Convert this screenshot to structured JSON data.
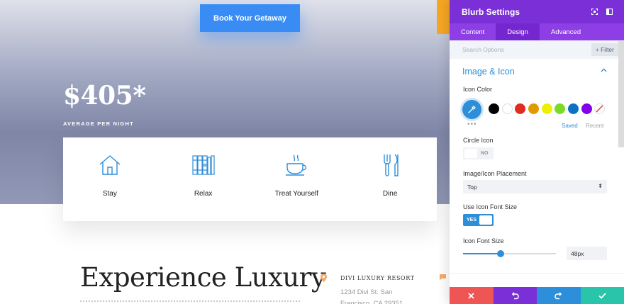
{
  "hero": {
    "cta_label": "Book Your Getaway",
    "price": "$405*",
    "price_caption": "AVERAGE PER NIGHT"
  },
  "features": [
    {
      "label": "Stay",
      "icon": "house-icon"
    },
    {
      "label": "Relax",
      "icon": "books-icon"
    },
    {
      "label": "Treat Yourself",
      "icon": "coffee-cup-icon"
    },
    {
      "label": "Dine",
      "icon": "fork-knife-icon"
    }
  ],
  "content": {
    "heading": "Experience Luxury",
    "resort_name": "DIVI LUXURY RESORT",
    "address_line1": "1234 Divi St. San",
    "address_line2": "Francisco, CA 29351"
  },
  "panel": {
    "title": "Blurb Settings",
    "tabs": [
      "Content",
      "Design",
      "Advanced"
    ],
    "active_tab": "Design",
    "search_placeholder": "Search Options",
    "filter_label": "+ Filter",
    "section_title": "Image & Icon",
    "icon_color_label": "Icon Color",
    "selected_color": "#2d8ed9",
    "swatches": [
      "#000000",
      "#ffffff",
      "#e02b20",
      "#e09900",
      "#edf000",
      "#7cda24",
      "#0c71c3",
      "#8300e9"
    ],
    "saved_label": "Saved",
    "recent_label": "Recent",
    "circle_icon_label": "Circle Icon",
    "circle_icon_value": "NO",
    "placement_label": "Image/Icon Placement",
    "placement_value": "Top",
    "use_font_size_label": "Use Icon Font Size",
    "use_font_size_value": "YES",
    "font_size_label": "Icon Font Size",
    "font_size_value": "48px",
    "font_size_slider_fraction": 0.4
  },
  "colors": {
    "accent_blue": "#2d8ed9",
    "panel_purple": "#7b2fd6",
    "cta_blue": "#3a8cf5",
    "cancel_red": "#ef5555",
    "save_green": "#29c4a9"
  }
}
